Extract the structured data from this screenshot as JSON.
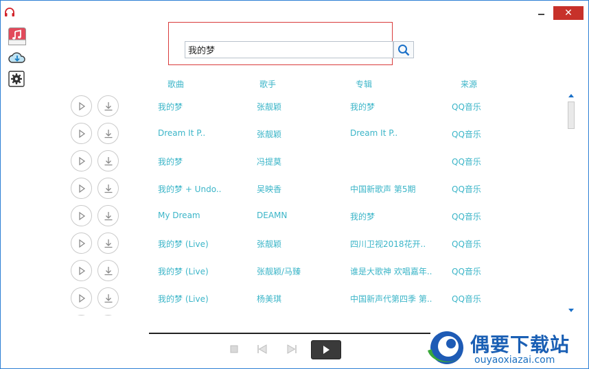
{
  "window": {
    "icon": "headphones-icon",
    "minimize_label": "",
    "close_label": "✕"
  },
  "sidebar": {
    "items": [
      {
        "name": "music-library",
        "icon": "music-note-icon"
      },
      {
        "name": "downloads",
        "icon": "cloud-download-icon"
      },
      {
        "name": "settings",
        "icon": "gear-icon"
      }
    ]
  },
  "search": {
    "value": "我的梦",
    "placeholder": "",
    "button_icon": "search-icon"
  },
  "table": {
    "headers": {
      "song": "歌曲",
      "artist": "歌手",
      "album": "专辑",
      "source": "来源"
    },
    "rows": [
      {
        "song": "我的梦",
        "artist": "张靓颖",
        "album": "我的梦",
        "source": "QQ音乐"
      },
      {
        "song": "Dream It P..",
        "artist": "张靓颖",
        "album": "Dream It P..",
        "source": "QQ音乐"
      },
      {
        "song": "我的梦",
        "artist": "冯提莫",
        "album": "",
        "source": "QQ音乐"
      },
      {
        "song": "我的梦 + Undo..",
        "artist": "吴映香",
        "album": "中国新歌声 第5期",
        "source": "QQ音乐"
      },
      {
        "song": "My Dream",
        "artist": "DEAMN",
        "album": "我的梦",
        "source": "QQ音乐"
      },
      {
        "song": "我的梦 (Live)",
        "artist": "张靓颖",
        "album": "四川卫视2018花开..",
        "source": "QQ音乐"
      },
      {
        "song": "我的梦 (Live)",
        "artist": "张靓颖/马臻",
        "album": "谁是大歌神 欢唱嘉年..",
        "source": "QQ音乐"
      },
      {
        "song": "我的梦 (Live)",
        "artist": "杨美琪",
        "album": "中国新声代第四季 第..",
        "source": "QQ音乐"
      },
      {
        "song": "",
        "artist": "",
        "album": "",
        "source": ""
      }
    ]
  },
  "player": {
    "progress": 0,
    "stop_icon": "stop-icon",
    "prev_icon": "previous-icon",
    "next_icon": "next-icon",
    "play_icon": "play-icon"
  },
  "watermark": {
    "title": "偶要下载站",
    "subtitle": "ouyaoxiazai.com"
  },
  "colors": {
    "accent": "#3bb5c8",
    "close": "#c7312a",
    "highlight": "#d93a3a",
    "watermark": "#1a5fb4"
  }
}
